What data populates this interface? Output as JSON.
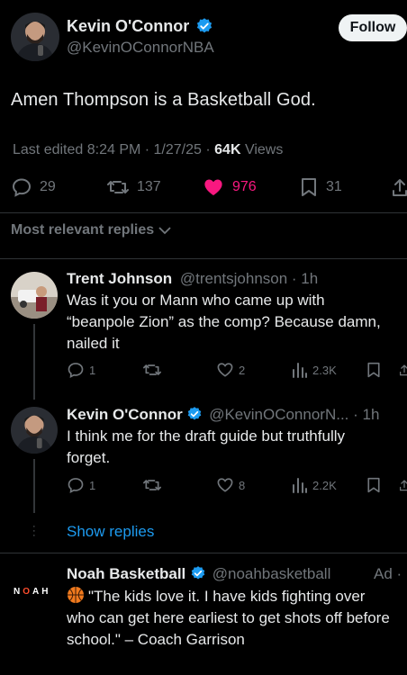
{
  "tweet": {
    "author_name": "Kevin O'Connor",
    "author_handle": "@KevinOConnorNBA",
    "follow_label": "Follow",
    "text": "Amen Thompson is a Basketball God.",
    "edited_label": "Last edited 8:24 PM · 1/27/25 · ",
    "views_count": "64K",
    "views_label": " Views",
    "replies": "29",
    "reposts": "137",
    "likes": "976",
    "bookmarks": "31",
    "like_color": "#f91880"
  },
  "replies_section": {
    "label": "Most relevant replies"
  },
  "replies": [
    {
      "name": "Trent Johnson",
      "handle": "@trentsjohnson",
      "time": "· 1h",
      "lines": [
        "Was it you or Mann who came up with",
        "“beanpole Zion” as the comp? Because damn,",
        "nailed it"
      ],
      "replies": "1",
      "reposts": "",
      "likes": "2",
      "views": "2.3K"
    },
    {
      "name": "Kevin O'Connor",
      "handle": "@KevinOConnorN...",
      "time": "· 1h",
      "lines": [
        "I think me for the draft guide but truthfully",
        "forget."
      ],
      "replies": "1",
      "reposts": "",
      "likes": "8",
      "views": "2.2K"
    }
  ],
  "show_replies_label": "Show replies",
  "ad": {
    "name": "Noah Basketball",
    "handle": "@noahbasketball",
    "ad_label": "Ad ·",
    "logo_text_1": "N",
    "logo_text_2": "O",
    "logo_text_3": "AH",
    "lines": [
      "\"The kids love it. I have kids fighting over",
      "who can get here earliest to get shots off before",
      "school.\" – Coach Garrison"
    ]
  },
  "accent_color": "#1d9bf0"
}
